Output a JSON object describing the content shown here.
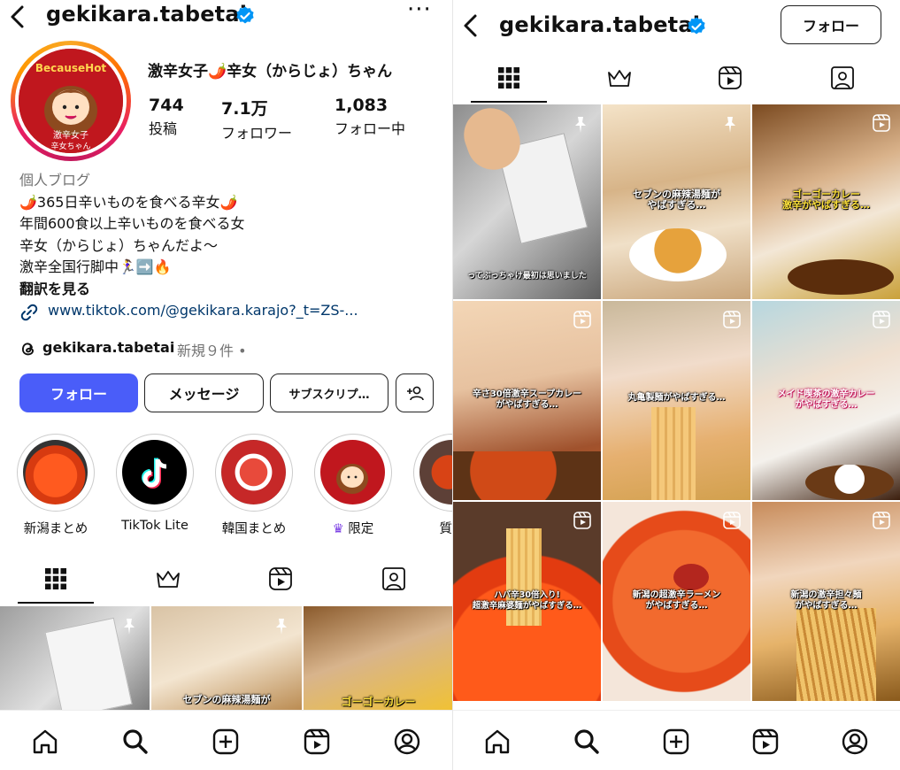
{
  "profile": {
    "username": "gekikara.tabetai",
    "display_name": "激辛女子🌶️辛女（からじょ）ちゃん",
    "avatar_text_top": "BecauseHot",
    "avatar_text_bottom": "激辛女子\n辛女ちゃん",
    "stats": [
      {
        "value": "744",
        "label": "投稿"
      },
      {
        "value": "7.1万",
        "label": "フォロワー"
      },
      {
        "value": "1,083",
        "label": "フォロー中"
      }
    ],
    "bio": {
      "category": "個人ブログ",
      "lines": [
        "🌶️365日辛いものを食べる辛女🌶️",
        "年間600食以上辛いものを食べる女",
        "辛女（からじょ）ちゃんだよ〜",
        "激辛全国行脚中🏃‍♀️➡️🔥"
      ],
      "translate": "翻訳を見る"
    },
    "link": "www.tiktok.com/@gekikara.karajo?_t=ZS-...",
    "threads": {
      "handle": "gekikara.tabetai",
      "note": "新規９件 •"
    },
    "buttons": {
      "follow": "フォロー",
      "message": "メッセージ",
      "subscribe": "サブスクリプ…"
    },
    "highlights": [
      {
        "label": "新潟まとめ"
      },
      {
        "label": "TikTok Lite"
      },
      {
        "label": "韓国まとめ"
      },
      {
        "label": "限定",
        "crown": "♛"
      },
      {
        "label": "質問"
      }
    ]
  },
  "right_header": {
    "follow_button": "フォロー"
  },
  "colors": {
    "accent": "#4a5df9",
    "verified": "#0095f6",
    "link": "#00376b"
  },
  "tabs": [
    "grid-icon",
    "crown-icon",
    "reels-icon",
    "tagged-icon"
  ],
  "posts": [
    {
      "caption": "ってぶっちゃけ最初は思いました",
      "pinned": true
    },
    {
      "caption": "セブンの麻辣湯麺が\nやばすぎる…",
      "pinned": true
    },
    {
      "caption": "ゴーゴーカレー\n激辛がやばすぎる…",
      "reel": true
    },
    {
      "caption": "辛さ30倍激辛スープカレー\nがやばすぎる…",
      "reel": true
    },
    {
      "caption": "丸亀製麺がやばすぎる…",
      "reel": true
    },
    {
      "caption": "メイド喫茶の激辛カレー\nがやばすぎる…",
      "reel": true
    },
    {
      "caption": "ハバ辛30倍入り!\n超激辛麻婆麺がやばすぎる…",
      "reel": true
    },
    {
      "caption": "新潟の超激辛ラーメン\nがやばすぎる…",
      "reel": true
    },
    {
      "caption": "新潟の激辛担々麺\nがやばすぎる…",
      "reel": true
    }
  ],
  "left_grid_captions": {
    "c2": "セブンの麻辣湯麺が",
    "c3": "ゴーゴーカレー"
  },
  "bottom_nav": [
    "home-icon",
    "search-icon",
    "create-icon",
    "reels-icon",
    "profile-icon"
  ]
}
